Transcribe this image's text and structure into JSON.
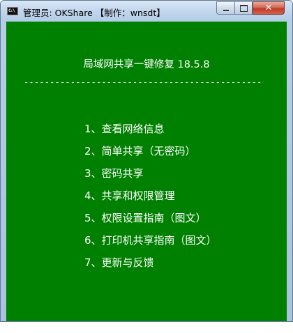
{
  "window": {
    "title": "管理员:  OKShare  【制作：wnsdt】",
    "icon": "cmd-console-icon",
    "icon_text": "C:\\",
    "controls": {
      "close_glyph": "✕"
    }
  },
  "console": {
    "background": "#008000",
    "text_color": "#ffffff",
    "heading": "局域网共享一键修复 18.5.8",
    "divider": "----------------------------------------------",
    "menu": [
      "1、查看网络信息",
      "2、简单共享（无密码）",
      "3、密码共享",
      "4、共享和权限管理",
      "5、权限设置指南（图文）",
      "6、打印机共享指南（图文）",
      "7、更新与反馈"
    ]
  }
}
